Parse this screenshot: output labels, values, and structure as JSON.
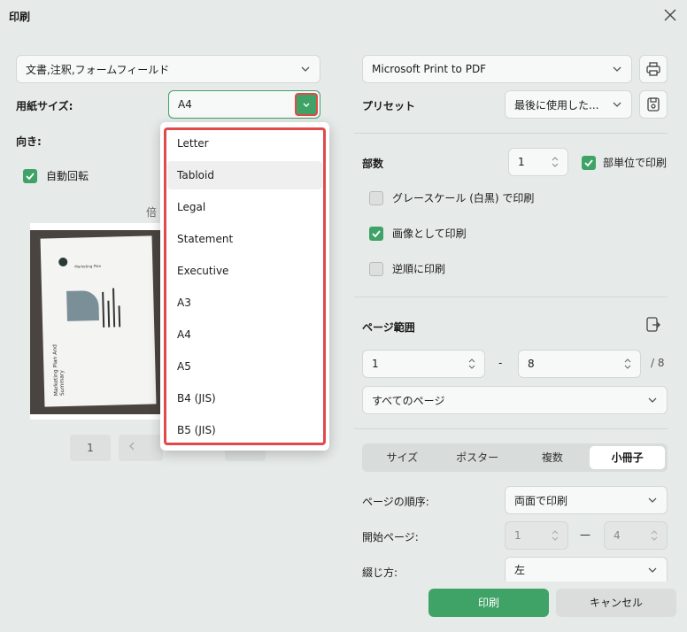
{
  "window": {
    "title": "印刷"
  },
  "left": {
    "content_select": "文書,注釈,フォームフィールド",
    "paper_size_label": "用紙サイズ:",
    "paper_size_value": "A4",
    "orientation_label": "向き:",
    "auto_rotate_label": "自動回転",
    "scale_label_partial": "倍",
    "page_number": "1",
    "preview": {
      "doc_title": "Marketing Plan And Summary",
      "doc_subtitle": "Marketing Plan"
    }
  },
  "paper_menu": {
    "items": [
      "Letter",
      "Tabloid",
      "Legal",
      "Statement",
      "Executive",
      "A3",
      "A4",
      "A5",
      "B4 (JIS)",
      "B5 (JIS)"
    ],
    "hovered": "Tabloid"
  },
  "right": {
    "printer": "Microsoft Print to PDF",
    "preset_label": "プリセット",
    "preset_value": "最後に使用した...",
    "copies_label": "部数",
    "copies_value": "1",
    "collate_label": "部単位で印刷",
    "grayscale_label": "グレースケール (白黒) で印刷",
    "as_image_label": "画像として印刷",
    "reverse_label": "逆順に印刷",
    "page_range_label": "ページ範囲",
    "range_from": "1",
    "range_dash": "-",
    "range_to": "8",
    "range_total": "/ 8",
    "range_select": "すべてのページ",
    "tabs": [
      "サイズ",
      "ポスター",
      "複数",
      "小冊子"
    ],
    "active_tab": "小冊子",
    "page_order_label": "ページの順序:",
    "page_order_value": "両面で印刷",
    "start_page_label": "開始ページ:",
    "start_page_from": "1",
    "start_page_dash": "—",
    "start_page_to": "4",
    "binding_label": "綴じ方:",
    "binding_value": "左"
  },
  "footer": {
    "print_label": "印刷",
    "cancel_label": "キャンセル"
  },
  "colors": {
    "accent": "#3fa368",
    "highlight": "#e04a4a",
    "background": "#e6eae8"
  }
}
